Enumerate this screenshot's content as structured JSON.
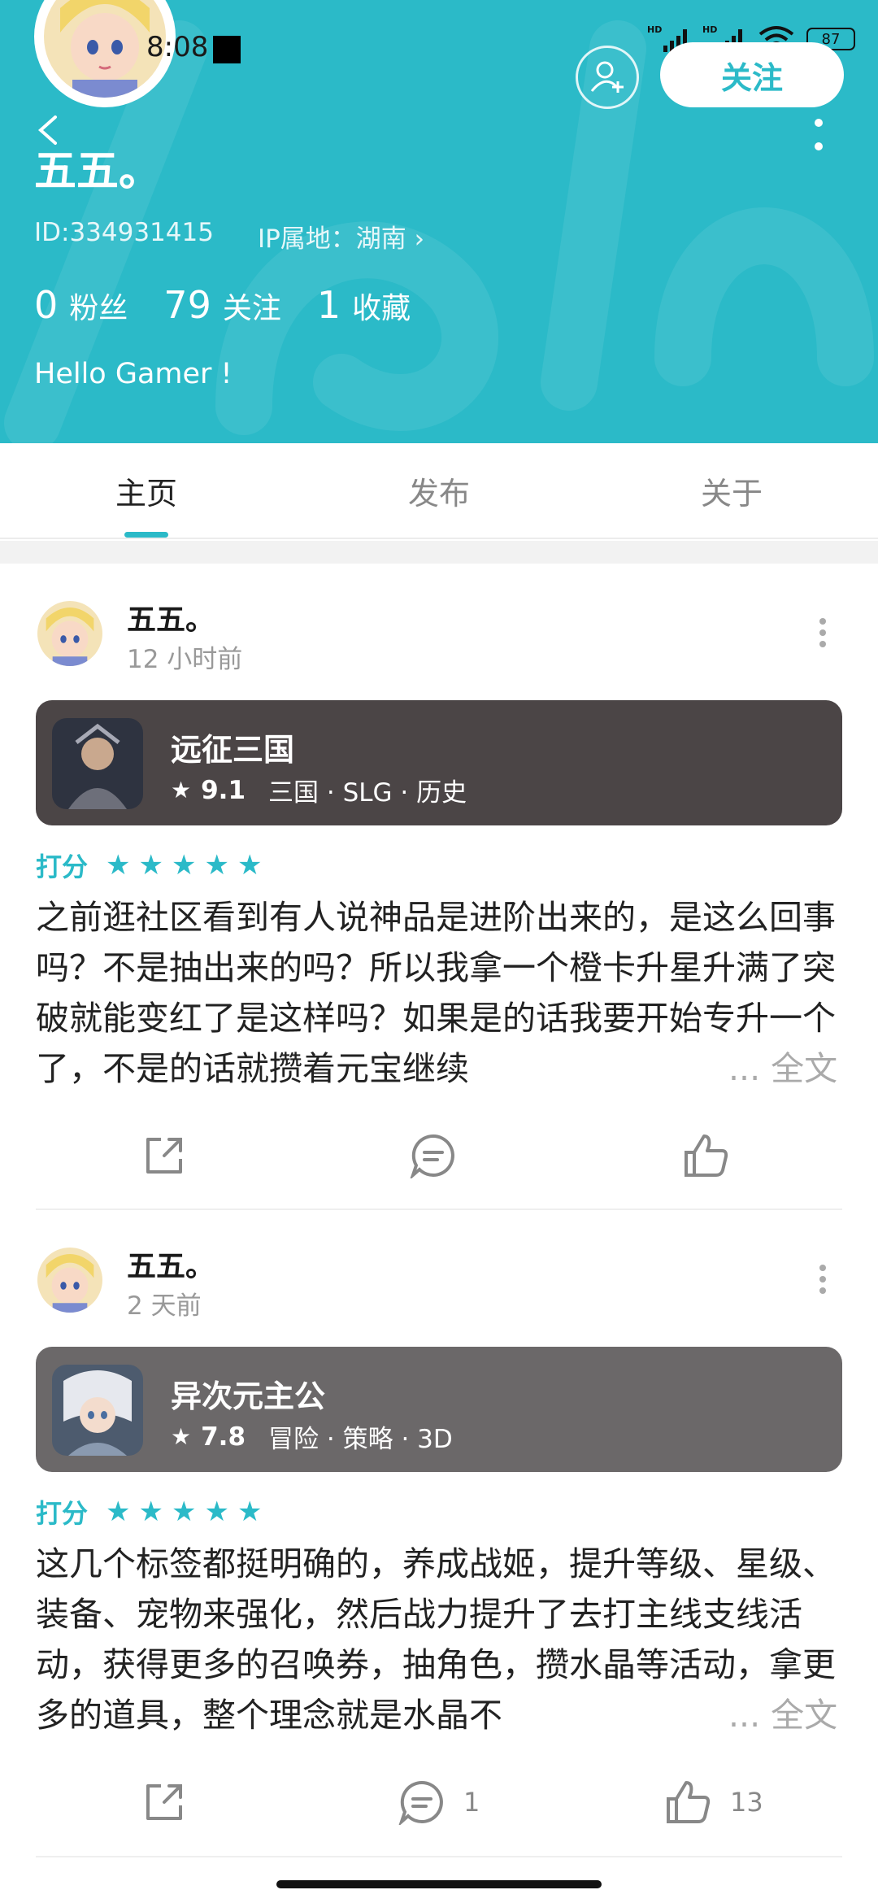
{
  "status_bar": {
    "time": "8:08",
    "battery": "87",
    "signal1": "HD",
    "signal2": "HD"
  },
  "profile": {
    "name": "五五。",
    "id_text": "ID:334931415",
    "ip_text": "IP属地：湖南",
    "followers_count": "0",
    "followers_label": "粉丝",
    "following_count": "79",
    "following_label": "关注",
    "favorites_count": "1",
    "favorites_label": "收藏",
    "bio": "Hello Gamer !",
    "follow_button": "关注"
  },
  "tabs": [
    {
      "label": "主页",
      "active": true
    },
    {
      "label": "发布",
      "active": false
    },
    {
      "label": "关于",
      "active": false
    }
  ],
  "posts": [
    {
      "author": "五五。",
      "time": "12 小时前",
      "game": {
        "name": "远征三国",
        "score": "9.1",
        "tags": "三国 · SLG · 历史",
        "card_color": "#4b4546"
      },
      "rating_label": "打分",
      "stars": 5,
      "content": "之前逛社区看到有人说神品是进阶出来的，是这么回事吗？不是抽出来的吗？所以我拿一个橙卡升星升满了突破就能变红了是这样吗？如果是的话我要开始专升一个了，不是的话就攒着元宝继续",
      "more": "... 全文",
      "comments": "",
      "likes": ""
    },
    {
      "author": "五五。",
      "time": "2 天前",
      "game": {
        "name": "异次元主公",
        "score": "7.8",
        "tags": "冒险 · 策略 · 3D",
        "card_color": "#6b6869"
      },
      "rating_label": "打分",
      "stars": 5,
      "content": "这几个标签都挺明确的，养成战姬，提升等级、星级、装备、宠物来强化，然后战力提升了去打主线支线活动，获得更多的召唤券，抽角色，攒水晶等活动，拿更多的道具，整个理念就是水晶不",
      "more": "... 全文",
      "comments": "1",
      "likes": "13"
    }
  ],
  "colors": {
    "accent": "#2bbac8"
  }
}
